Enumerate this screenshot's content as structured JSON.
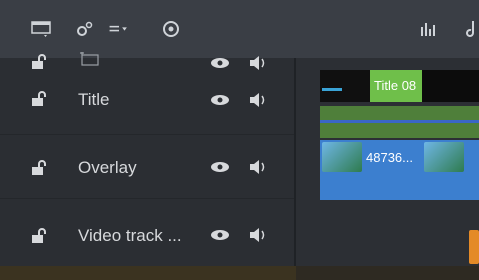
{
  "toolbar": {
    "icons": [
      "window-layout-icon",
      "settings-icon",
      "track-menu-icon",
      "disc-icon",
      "audio-levels-icon",
      "music-icon"
    ]
  },
  "tracks": [
    {
      "label": "",
      "lock_icon": "lock-icon",
      "eye_icon": "eye-icon",
      "speaker_icon": "speaker-icon"
    },
    {
      "label": "Title"
    },
    {
      "label": "Overlay"
    },
    {
      "label": "Video track ..."
    }
  ],
  "timeline": {
    "title_clip": {
      "name": "Title 08"
    },
    "overlay_clip": {
      "name": "48736..."
    }
  },
  "colors": {
    "title_clip": "#6fbf4a",
    "overlay_clip": "#3c7fcf",
    "marker": "#e48a27"
  }
}
